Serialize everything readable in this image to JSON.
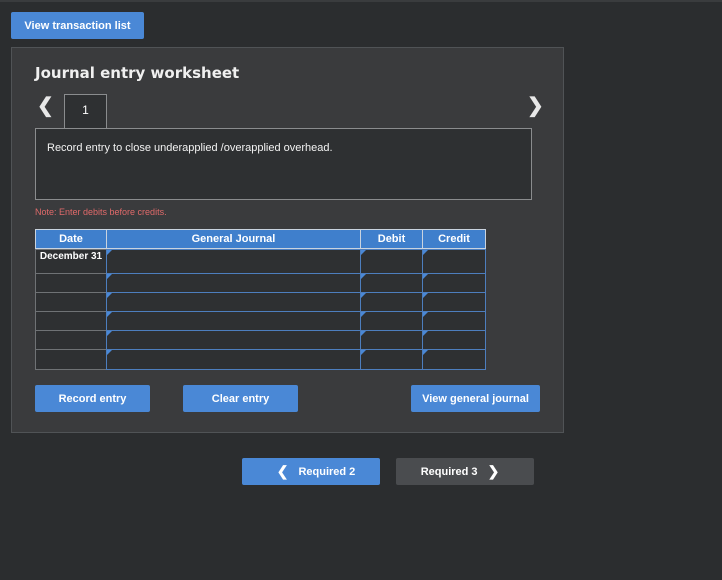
{
  "top_button_label": "View transaction list",
  "worksheet": {
    "title": "Journal entry worksheet",
    "prev_icon": "chevron-left",
    "next_icon": "chevron-right",
    "tabs": [
      {
        "label": "1"
      }
    ],
    "description": "Record entry to close underapplied /overapplied overhead.",
    "note": "Note: Enter debits before credits.",
    "table": {
      "headers": [
        "Date",
        "General Journal",
        "Debit",
        "Credit"
      ],
      "rows": [
        {
          "date": "December 31",
          "general_journal": "",
          "debit": "",
          "credit": ""
        },
        {
          "date": "",
          "general_journal": "",
          "debit": "",
          "credit": ""
        },
        {
          "date": "",
          "general_journal": "",
          "debit": "",
          "credit": ""
        },
        {
          "date": "",
          "general_journal": "",
          "debit": "",
          "credit": ""
        },
        {
          "date": "",
          "general_journal": "",
          "debit": "",
          "credit": ""
        },
        {
          "date": "",
          "general_journal": "",
          "debit": "",
          "credit": ""
        }
      ]
    },
    "buttons": {
      "record": "Record entry",
      "clear": "Clear entry",
      "view_general_journal": "View general journal"
    }
  },
  "navigation": {
    "prev_label": "Required 2",
    "next_label": "Required 3"
  },
  "colors": {
    "background": "#2b2d2f",
    "accent": "#4a88d6",
    "note": "#e06a6a"
  }
}
